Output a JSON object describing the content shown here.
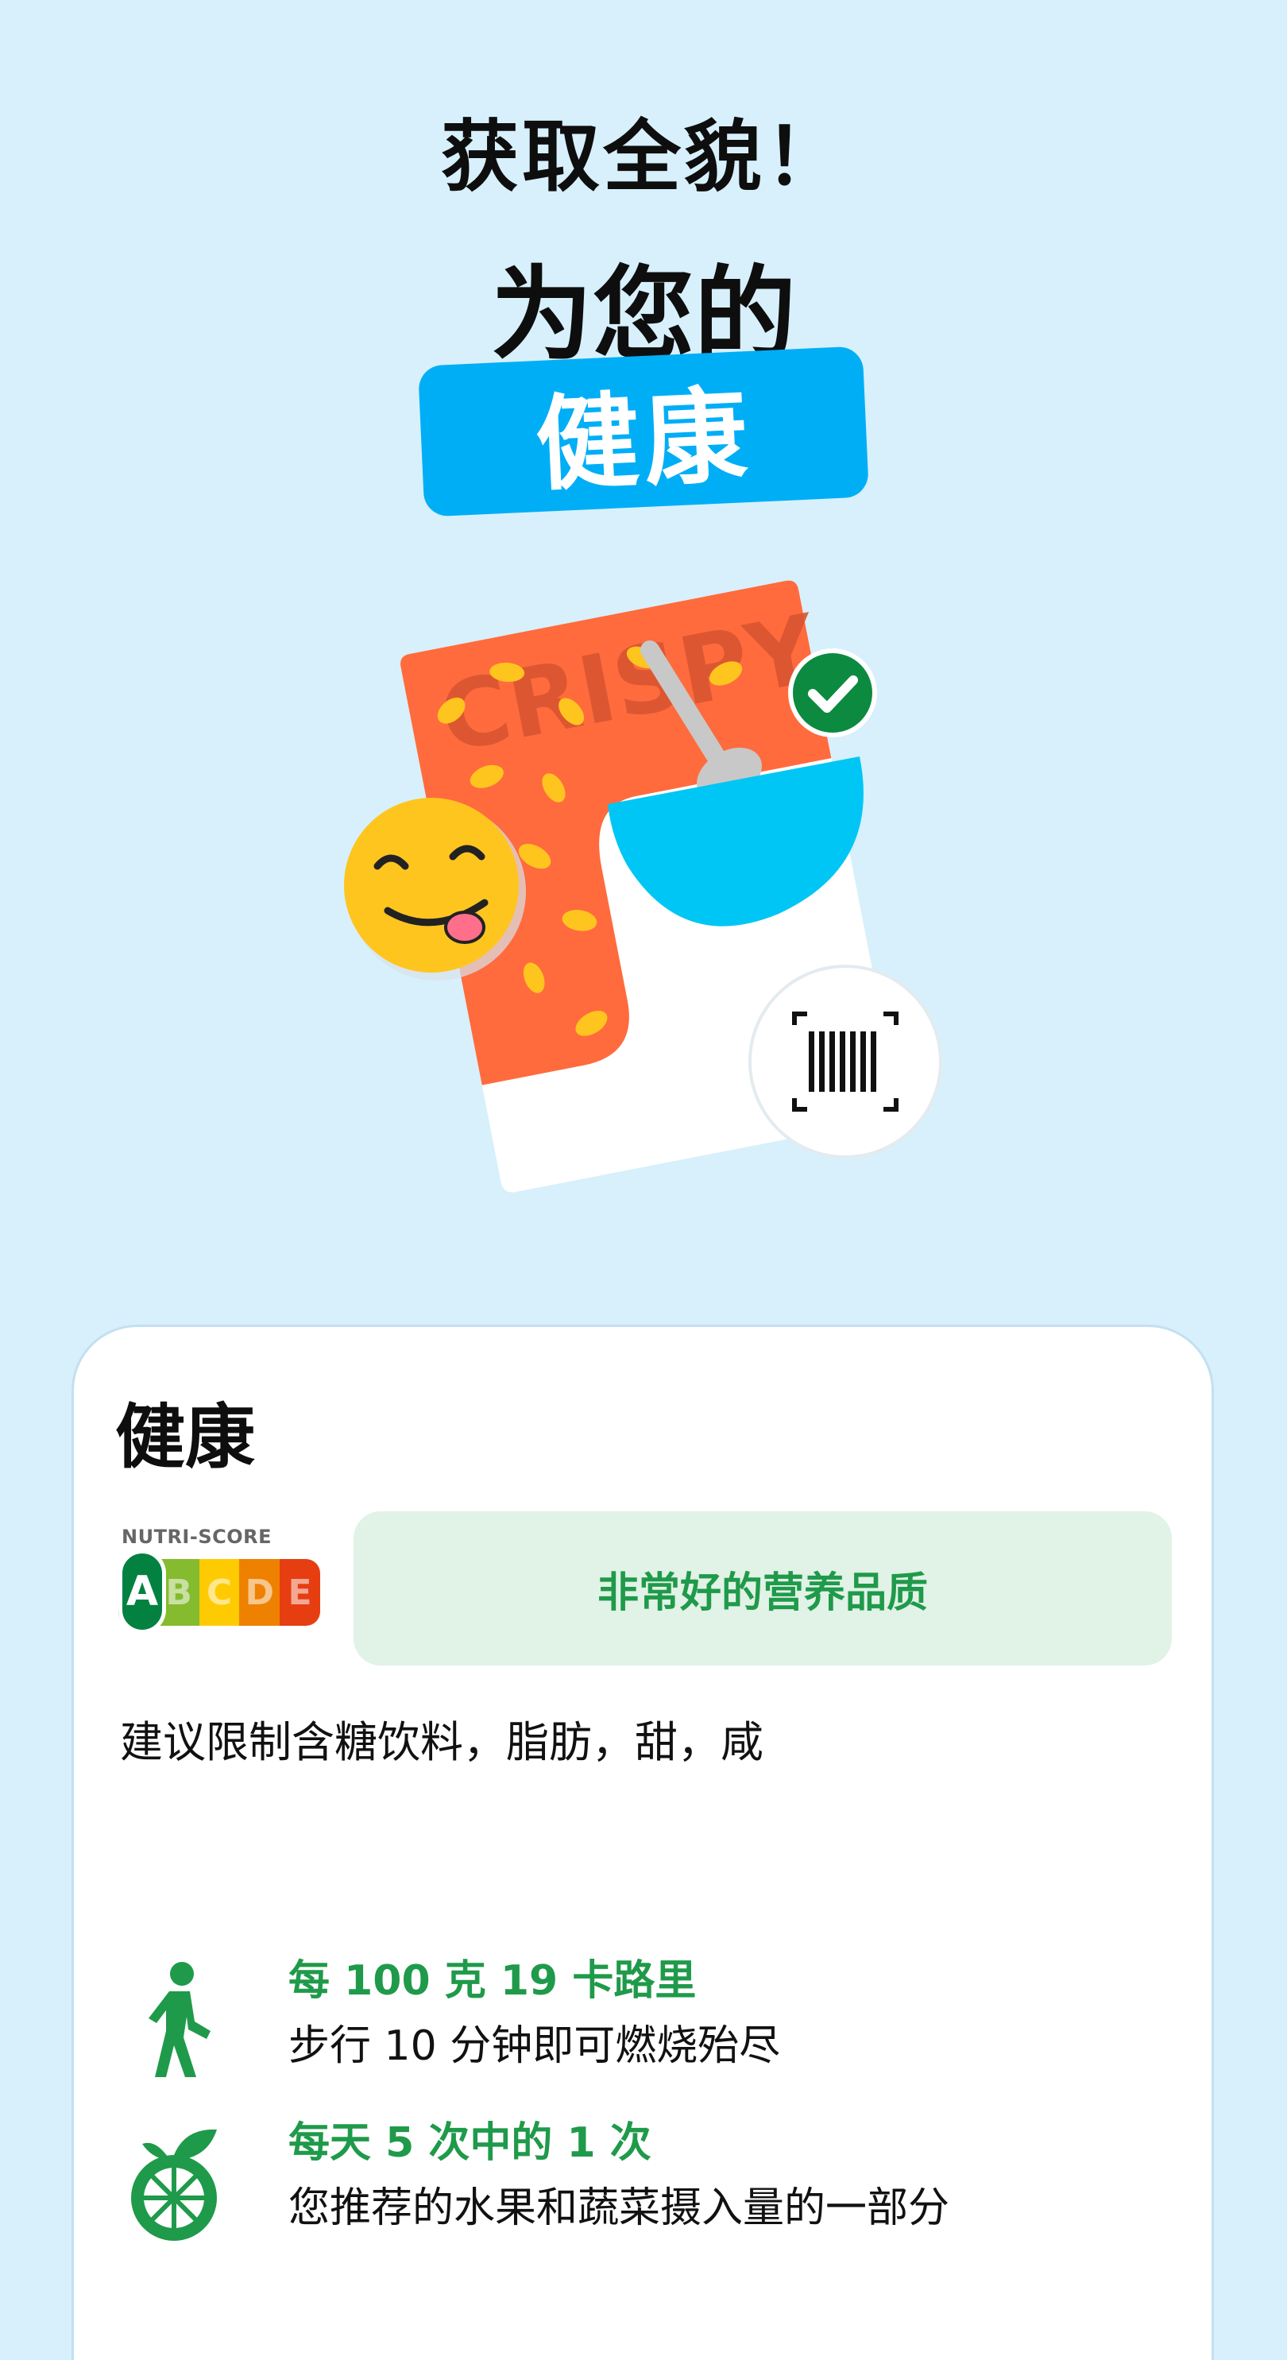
{
  "header": {
    "line1": "获取全貌！",
    "line2": "为您的",
    "highlight": "健康"
  },
  "illustration": {
    "package_text": "CRISPY",
    "icons": [
      "smiley-face-icon",
      "checkmark-icon",
      "barcode-scan-icon",
      "cereal-bowl-icon"
    ]
  },
  "card": {
    "title": "健康",
    "nutri_score": {
      "label": "NUTRI-SCORE",
      "grades": [
        "A",
        "B",
        "C",
        "D",
        "E"
      ],
      "colors": [
        "#038141",
        "#85bb2f",
        "#fecb02",
        "#ee8100",
        "#e63e11"
      ],
      "selected": "A"
    },
    "quality_label": "非常好的营养品质",
    "advice": "建议限制含糖饮料，脂肪，甜，咸",
    "facts": [
      {
        "icon": "walking-person-icon",
        "headline": "每 100 克 19 卡路里",
        "detail": "步行 10 分钟即可燃烧殆尽"
      },
      {
        "icon": "citrus-fruit-icon",
        "headline": "每天 5 次中的 1 次",
        "detail": "您推荐的水果和蔬菜摄入量的一部分"
      }
    ]
  },
  "colors": {
    "background": "#d7f0fb",
    "accent_blue": "#00aef6",
    "accent_green": "#1f9a4a",
    "package_orange": "#ff6b3d"
  }
}
